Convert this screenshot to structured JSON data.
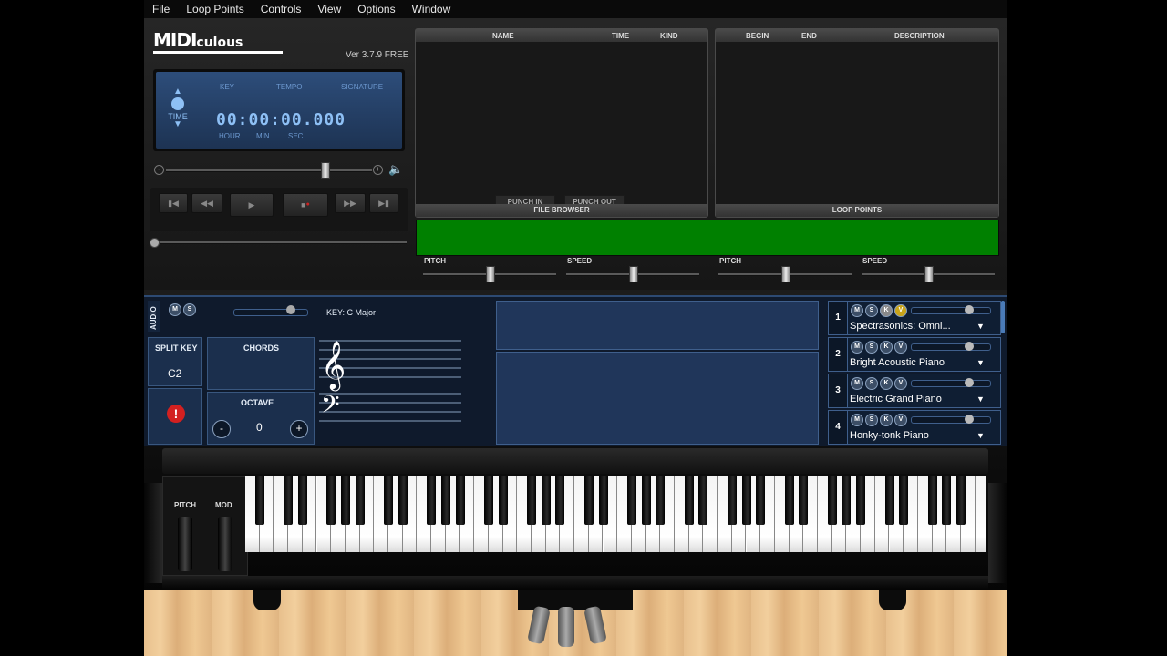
{
  "menu": [
    "File",
    "Loop Points",
    "Controls",
    "View",
    "Options",
    "Window"
  ],
  "app": {
    "logo_main": "MIDI",
    "logo_sub": "culous",
    "version": "Ver 3.7.9 FREE"
  },
  "lcd": {
    "key_label": "KEY",
    "tempo_label": "TEMPO",
    "signature_label": "SIGNATURE",
    "time_label": "TIME",
    "time_value": "00:00:00.000",
    "hour_label": "HOUR",
    "min_label": "MIN",
    "sec_label": "SEC"
  },
  "file_browser": {
    "col_name": "NAME",
    "col_time": "TIME",
    "col_kind": "KIND",
    "punch_in": "PUNCH IN",
    "punch_out": "PUNCH OUT",
    "title": "FILE BROWSER"
  },
  "loop_points": {
    "col_begin": "BEGIN",
    "col_end": "END",
    "col_description": "DESCRIPTION",
    "title": "LOOP POINTS"
  },
  "pitch_speed": {
    "pitch": "PITCH",
    "speed": "SPEED"
  },
  "audio": {
    "label": "AUDIO",
    "m": "M",
    "s": "S"
  },
  "split_key": {
    "label": "SPLIT KEY",
    "value": "C2"
  },
  "chords": {
    "label": "CHORDS"
  },
  "octave": {
    "label": "OCTAVE",
    "value": "0",
    "minus": "-",
    "plus": "+"
  },
  "staff": {
    "key_text": "KEY: C Major"
  },
  "tracks": [
    {
      "num": "1",
      "name": "Spectrasonics: Omni..."
    },
    {
      "num": "2",
      "name": "Bright Acoustic Piano"
    },
    {
      "num": "3",
      "name": "Electric Grand Piano"
    },
    {
      "num": "4",
      "name": "Honky-tonk Piano"
    }
  ],
  "track_buttons": {
    "m": "M",
    "s": "S",
    "k": "K",
    "v": "V"
  },
  "wheels": {
    "pitch": "PITCH",
    "mod": "MOD"
  },
  "colors": {
    "accent_green": "#008000",
    "lcd_blue": "#2d4d7a",
    "panel_blue": "#1b2f4d"
  }
}
